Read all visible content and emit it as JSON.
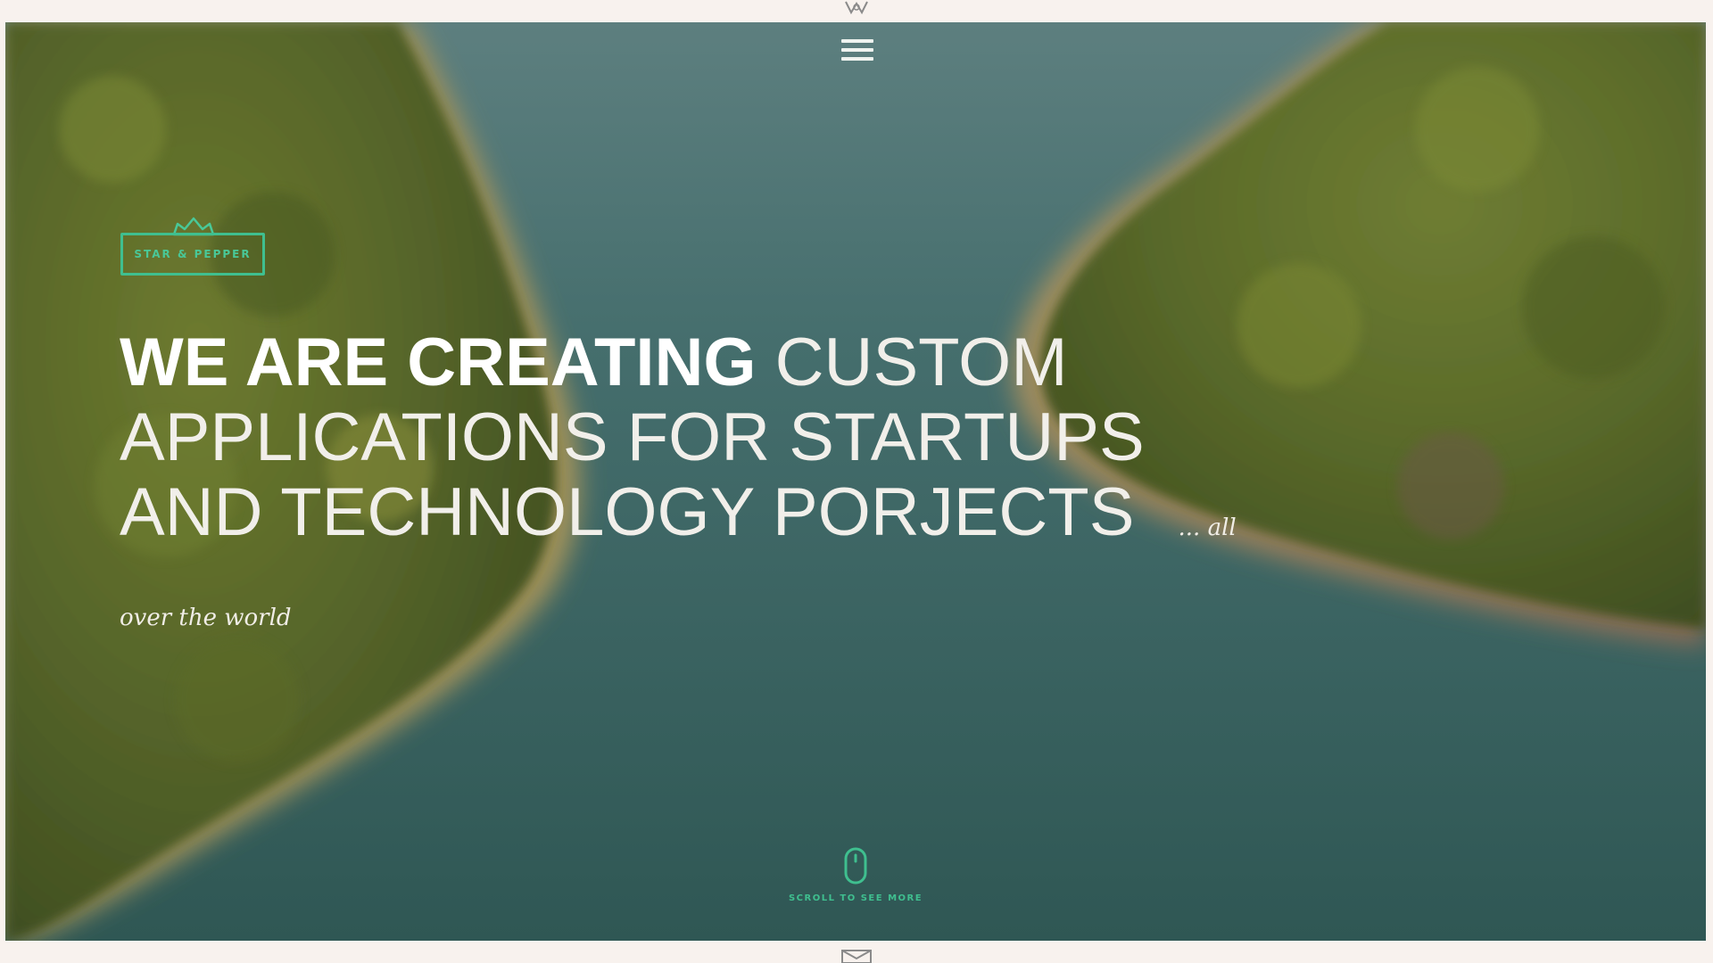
{
  "header": {
    "emblem_icon": "crest-icon",
    "menu_icon": "hamburger-icon"
  },
  "logo": {
    "text": "STAR & PEPPER",
    "crown_icon": "crown-icon",
    "color": "#49c898"
  },
  "hero": {
    "headline_strong": "WE ARE CREATING",
    "headline_light": "CUSTOM APPLICATIONS FOR STARTUPS AND TECHNOLOGY PORJECTS",
    "tagline": "... all over the world",
    "background": "aerial-forest-lake-photo"
  },
  "scroll": {
    "icon": "mouse-icon",
    "label": "SCROLL TO SEE MORE",
    "color": "#3fbf8f"
  },
  "footer": {
    "emblem_icon": "envelope-icon"
  },
  "colors": {
    "page_background": "#f8f2ee",
    "accent": "#3fbf8f",
    "water": "#3f6664",
    "forest": "#55652a"
  }
}
